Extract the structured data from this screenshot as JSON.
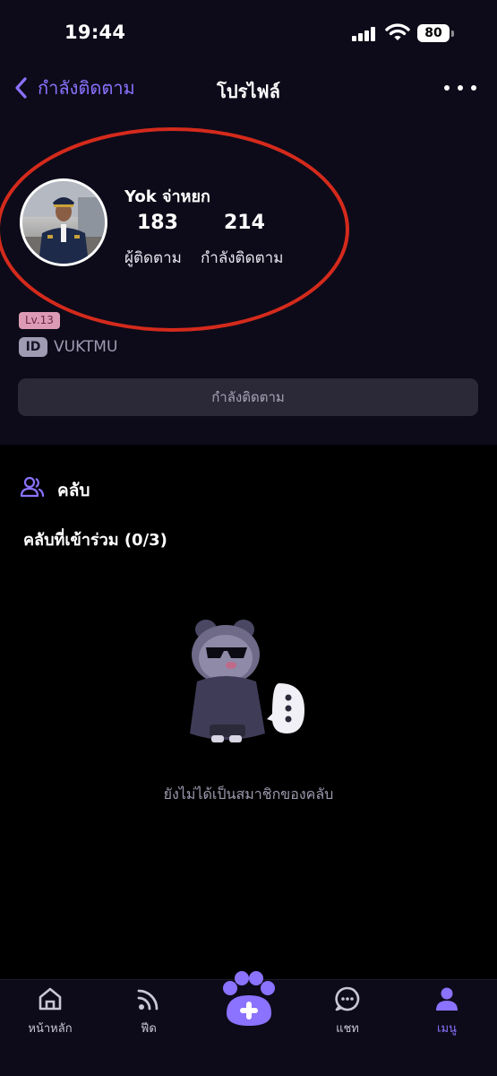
{
  "status_bar": {
    "time": "19:44",
    "battery": "80"
  },
  "header": {
    "back_label": "กำลังติดตาม",
    "title": "โปรไฟล์"
  },
  "profile": {
    "name": "Yok จ่าหยก",
    "followers_count": "183",
    "followers_label": "ผู้ติดตาม",
    "following_count": "214",
    "following_label": "กำลังติดตาม",
    "level": "Lv.13",
    "id_badge": "ID",
    "id_value": "VUKTMU",
    "follow_button": "กำลังติดตาม"
  },
  "clubs": {
    "title": "คลับ",
    "joined_label": "คลับที่เข้าร่วม (0/3)",
    "empty_text": "ยังไม่ได้เป็นสมาชิกของคลับ"
  },
  "tabbar": {
    "items": [
      {
        "label": "หน้าหลัก",
        "icon": "home-icon"
      },
      {
        "label": "ฟีด",
        "icon": "feed-icon"
      },
      {
        "label": "",
        "icon": "paw-plus-icon"
      },
      {
        "label": "แชท",
        "icon": "chat-icon"
      },
      {
        "label": "เมนู",
        "icon": "person-icon",
        "active": true
      }
    ]
  },
  "colors": {
    "accent": "#8b72ff",
    "annotation": "#d42a1c",
    "level_badge": "#dc9bb4",
    "panel": "#0d0b19"
  }
}
